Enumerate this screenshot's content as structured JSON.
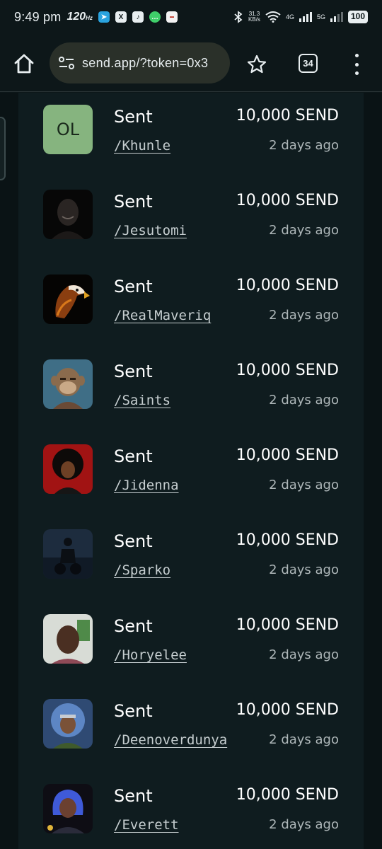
{
  "status_bar": {
    "time": "9:49 pm",
    "refresh_rate": "120",
    "refresh_unit": "Hz",
    "net_speed_value": "31.3",
    "net_speed_unit": "KB/s",
    "net_4g": "4G",
    "net_5g": "5G",
    "battery": "100",
    "apps": [
      "telegram-icon",
      "x-icon",
      "tiktok-icon",
      "chat-icon",
      "news-icon"
    ]
  },
  "browser": {
    "url": "send.app/?token=0x3",
    "tab_count": "34"
  },
  "transactions": [
    {
      "label": "Sent",
      "handle": "/Khunle",
      "amount": "10,000 SEND",
      "time": "2 days ago",
      "initials": "OL"
    },
    {
      "label": "Sent",
      "handle": "/Jesutomi",
      "amount": "10,000 SEND",
      "time": "2 days ago"
    },
    {
      "label": "Sent",
      "handle": "/RealMaveriq",
      "amount": "10,000 SEND",
      "time": "2 days ago"
    },
    {
      "label": "Sent",
      "handle": "/Saints",
      "amount": "10,000 SEND",
      "time": "2 days ago"
    },
    {
      "label": "Sent",
      "handle": "/Jidenna",
      "amount": "10,000 SEND",
      "time": "2 days ago"
    },
    {
      "label": "Sent",
      "handle": "/Sparko",
      "amount": "10,000 SEND",
      "time": "2 days ago"
    },
    {
      "label": "Sent",
      "handle": "/Horyelee",
      "amount": "10,000 SEND",
      "time": "2 days ago"
    },
    {
      "label": "Sent",
      "handle": "/Deenoverdunya",
      "amount": "10,000 SEND",
      "time": "2 days ago"
    },
    {
      "label": "Sent",
      "handle": "/Everett",
      "amount": "10,000 SEND",
      "time": "2 days ago"
    }
  ]
}
